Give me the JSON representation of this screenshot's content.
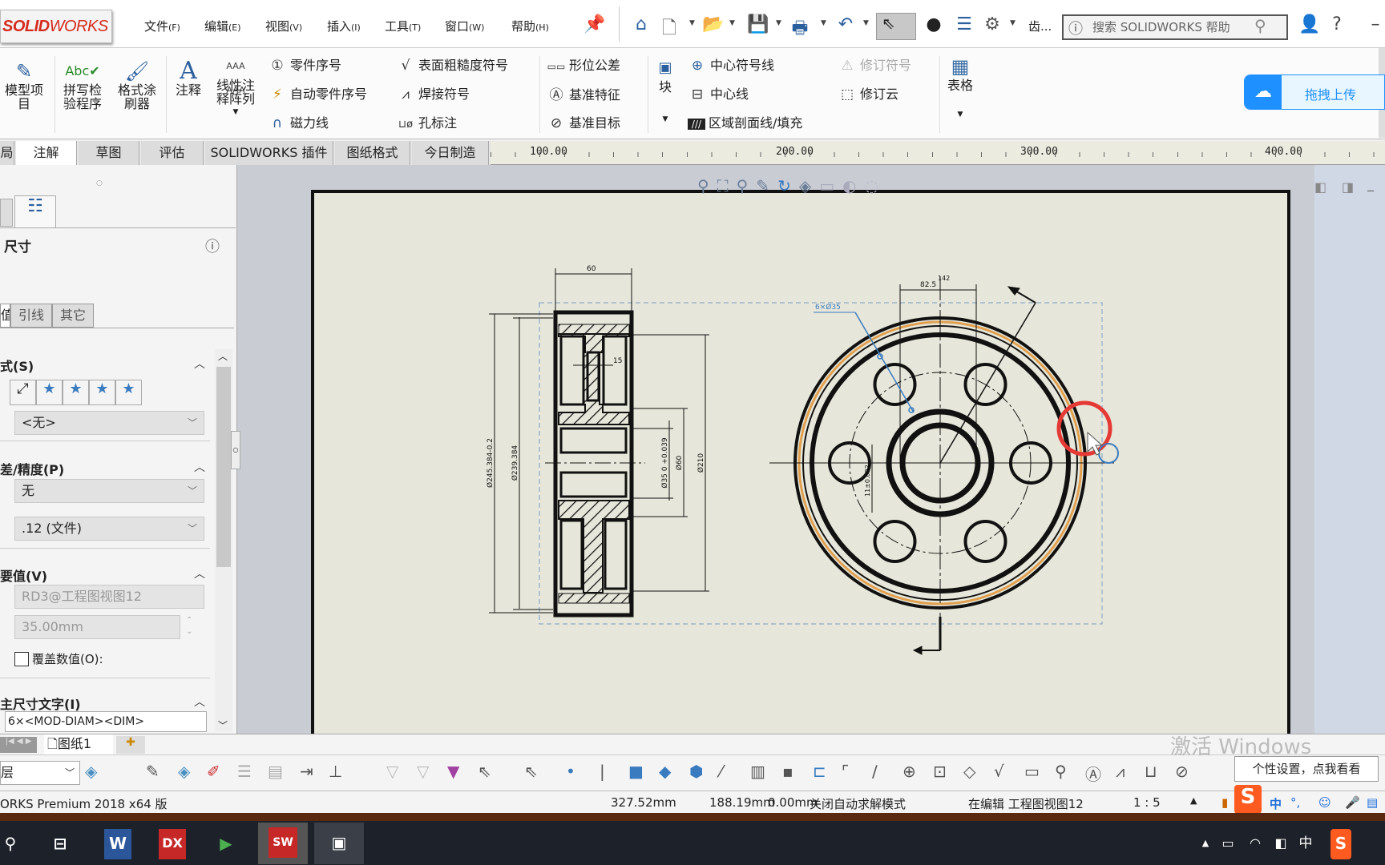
{
  "app": {
    "logo": "SOLIDWORKS"
  },
  "menu": [
    "文件",
    "编辑",
    "视图",
    "插入",
    "工具",
    "窗口",
    "帮助"
  ],
  "menu_keys": [
    "(F)",
    "(E)",
    "(V)",
    "(I)",
    "(T)",
    "(W)",
    "(H)"
  ],
  "search": {
    "placeholder": "搜索 SOLIDWORKS 帮助"
  },
  "toolbar": {
    "more": "齿..."
  },
  "ribbon": {
    "model_items": "模型项目",
    "spell": "拼写检验程序",
    "format_painter": "格式涂刷器",
    "note": "注释",
    "linear_note": "线性注释阵列",
    "col1": [
      "零件序号",
      "自动零件序号",
      "磁力线"
    ],
    "col2": [
      "表面粗糙度符号",
      "焊接符号",
      "孔标注"
    ],
    "col3": [
      "形位公差",
      "基准特征",
      "基准目标"
    ],
    "block": "块",
    "col4": [
      "中心符号线",
      "中心线",
      "区域剖面线/填充"
    ],
    "col5": [
      "修订符号",
      "修订云"
    ],
    "table": "表格",
    "upload": "拖拽上传"
  },
  "tabs": [
    "局",
    "注解",
    "草图",
    "评估",
    "SOLIDWORKS 插件",
    "图纸格式",
    "今日制造"
  ],
  "ruler": [
    "100.00",
    "200.00",
    "300.00",
    "400.00"
  ],
  "panel": {
    "title": "尺寸",
    "subtabs": [
      "值",
      "引线",
      "其它"
    ],
    "style_section": "式(S)",
    "style_value": "<无>",
    "tol_section": "差/精度(P)",
    "tol_value": "无",
    "precision_value": ".12 (文件)",
    "primary_section": "要值(V)",
    "ref_value": "RD3@工程图视图12",
    "dim_value": "35.00mm",
    "override_label": "覆盖数值(O):",
    "override_checked": false,
    "text_section": "主尺寸文字(I)",
    "dim_text": "6×<MOD-DIAM><DIM>"
  },
  "drawing": {
    "dim_width": "60",
    "dim_od": "Ø245.384-0.2",
    "dim_pitch": "Ø239.384",
    "dim_210": "Ø210",
    "dim_60": "Ø60",
    "dim_bore": "Ø35 0 +0.039",
    "dim_82": "82.5",
    "dim_142": "142",
    "dim_holes": "6×Ø35",
    "dim_key": "11±0.022"
  },
  "sheet_tab": "图纸1",
  "layer": "层",
  "status": {
    "product": "ORKS Premium 2018 x64 版",
    "x": "327.52mm",
    "y": "188.19mm",
    "z": "0.00mm",
    "solve": "关闭自动求解模式",
    "editing": "在编辑 工程图视图12",
    "scale": "1 : 5"
  },
  "tooltip": "个性设置，点我看看",
  "watermark": "激活 Windows",
  "ime": "中",
  "colors": {
    "accent": "#1e90ff",
    "sheet": "#e6e6da",
    "highlight": "#e0a050",
    "cursor_ring": "#e53935"
  }
}
